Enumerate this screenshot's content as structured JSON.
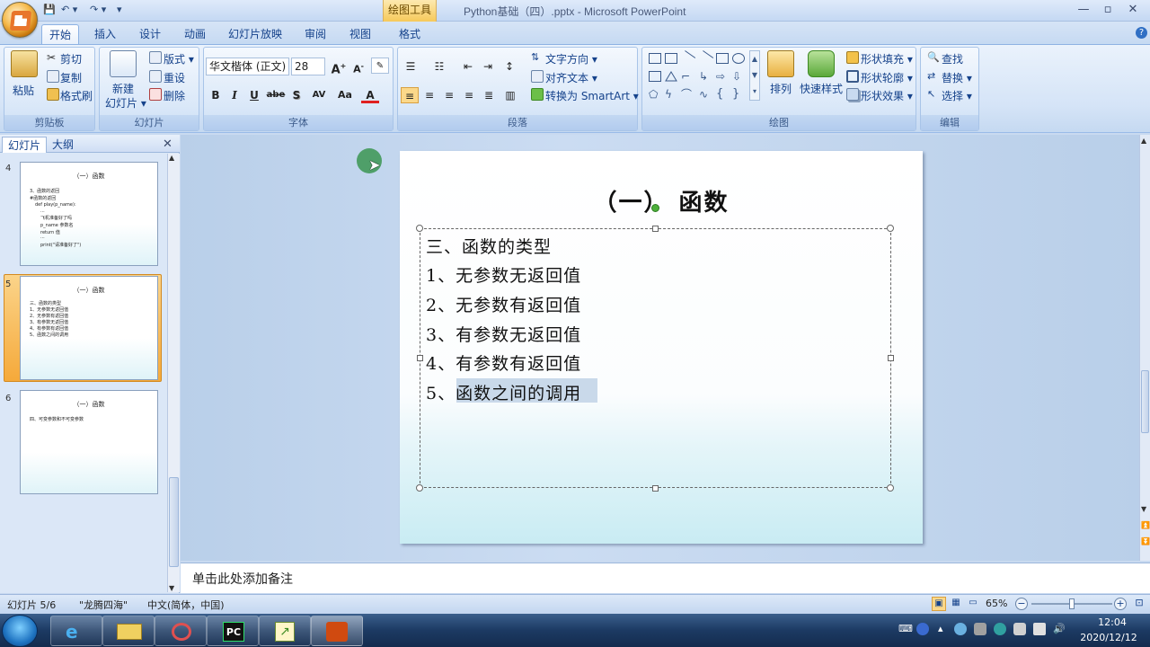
{
  "window": {
    "title": "Python基础（四）.pptx - Microsoft PowerPoint",
    "context_tab": "绘图工具",
    "minimize": "—",
    "restore": "▫",
    "close": "✕"
  },
  "tabs": [
    "开始",
    "插入",
    "设计",
    "动画",
    "幻灯片放映",
    "审阅",
    "视图",
    "格式"
  ],
  "ribbon": {
    "clipboard": {
      "label": "剪贴板",
      "paste": "粘贴",
      "cut": "剪切",
      "copy": "复制",
      "format_painter": "格式刷"
    },
    "slides": {
      "label": "幻灯片",
      "new_slide": "新建",
      "new_slide2": "幻灯片 ▾",
      "layout": "版式 ▾",
      "reset": "重设",
      "delete": "删除"
    },
    "font": {
      "label": "字体",
      "font_name": "华文楷体 (正文)",
      "font_size": "28",
      "bold": "B",
      "italic": "I",
      "underline": "U",
      "strike": "abe",
      "shadow": "S",
      "spacing": "AV",
      "case": "Aa",
      "color": "A"
    },
    "paragraph": {
      "label": "段落",
      "text_direction": "文字方向 ▾",
      "align_text": "对齐文本 ▾",
      "smartart": "转换为 SmartArt ▾"
    },
    "drawing": {
      "label": "绘图",
      "arrange": "排列",
      "quick_styles": "快速样式",
      "shape_fill": "形状填充 ▾",
      "shape_outline": "形状轮廓 ▾",
      "shape_effects": "形状效果 ▾"
    },
    "editing": {
      "label": "编辑",
      "find": "查找",
      "replace": "替换 ▾",
      "select": "选择 ▾"
    }
  },
  "left_pane": {
    "tab_slides": "幻灯片",
    "tab_outline": "大纲",
    "close": "✕",
    "thumbnails": [
      {
        "num": "4",
        "title": "（一）函数",
        "lines": [
          "3、函数的返回",
          "#函数的返回",
          "def play(p_name):",
          "  ...",
          "  飞机准备好了吗",
          "  p_name 参数名",
          "  return 值",
          "  ...",
          "print(\"请准备好了\")"
        ]
      },
      {
        "num": "5",
        "title": "（一）函数",
        "lines": [
          "三、函数的类型",
          "1、无参数无返回值",
          "2、无参数有返回值",
          "3、有参数无返回值",
          "4、有参数有返回值",
          "5、函数之间的调用"
        ]
      },
      {
        "num": "6",
        "title": "（一）函数",
        "lines": [
          "四、可变参数和不可变参数"
        ]
      }
    ]
  },
  "slide": {
    "title": "（一） 函数",
    "lines": [
      "三、函数的类型",
      "1、无参数无返回值",
      "2、无参数有返回值",
      "3、有参数无返回值",
      "4、有参数有返回值",
      "5、函数之间的调用"
    ]
  },
  "notes": {
    "placeholder": "单击此处添加备注"
  },
  "status": {
    "slide": "幻灯片 5/6",
    "theme": "\"龙腾四海\"",
    "language": "中文(简体，中国)",
    "zoom": "65%",
    "zoom_fraction": 0.5
  },
  "taskbar": {
    "time": "12:04",
    "date": "2020/12/12"
  }
}
